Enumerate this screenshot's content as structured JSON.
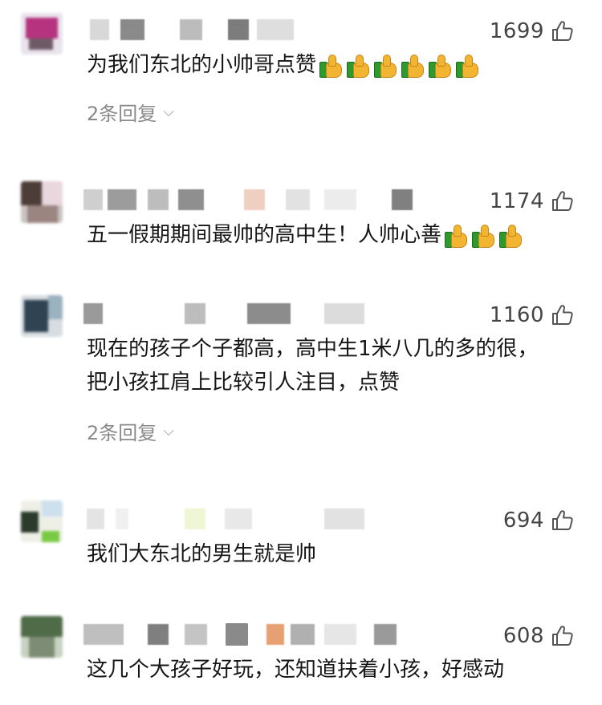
{
  "comments": [
    {
      "likes": "1699",
      "text": "为我们东北的小帅哥点赞",
      "emoji": [
        "thumbs-up-emoji",
        "thumbs-up-emoji",
        "thumbs-up-emoji",
        "thumbs-up-emoji",
        "thumbs-up-emoji",
        "thumbs-up-emoji"
      ],
      "reply_label": "2条回复",
      "reply_chevron": "⌵"
    },
    {
      "likes": "1174",
      "text": "五一假期期间最帅的高中生！人帅心善",
      "emoji": [
        "thumbs-up-emoji",
        "thumbs-up-emoji",
        "thumbs-up-emoji"
      ]
    },
    {
      "likes": "1160",
      "text_line1": "现在的孩子个子都高，高中生1米八几的多的很，",
      "text_line2": "把小孩扛肩上比较引人注目，点赞",
      "reply_label": "2条回复",
      "reply_chevron": "⌵"
    },
    {
      "likes": "694",
      "text": "我们大东北的男生就是帅"
    },
    {
      "likes": "608",
      "text": "这几个大孩子好玩，还知道扶着小孩，好感动"
    }
  ],
  "icons": {
    "like": "thumb-up-outline-icon"
  },
  "colors": {
    "like_count": "#444444",
    "reply": "#8a8a8a",
    "emoji_thumb": "#f2b531",
    "emoji_cuff": "#2e9a2e"
  }
}
